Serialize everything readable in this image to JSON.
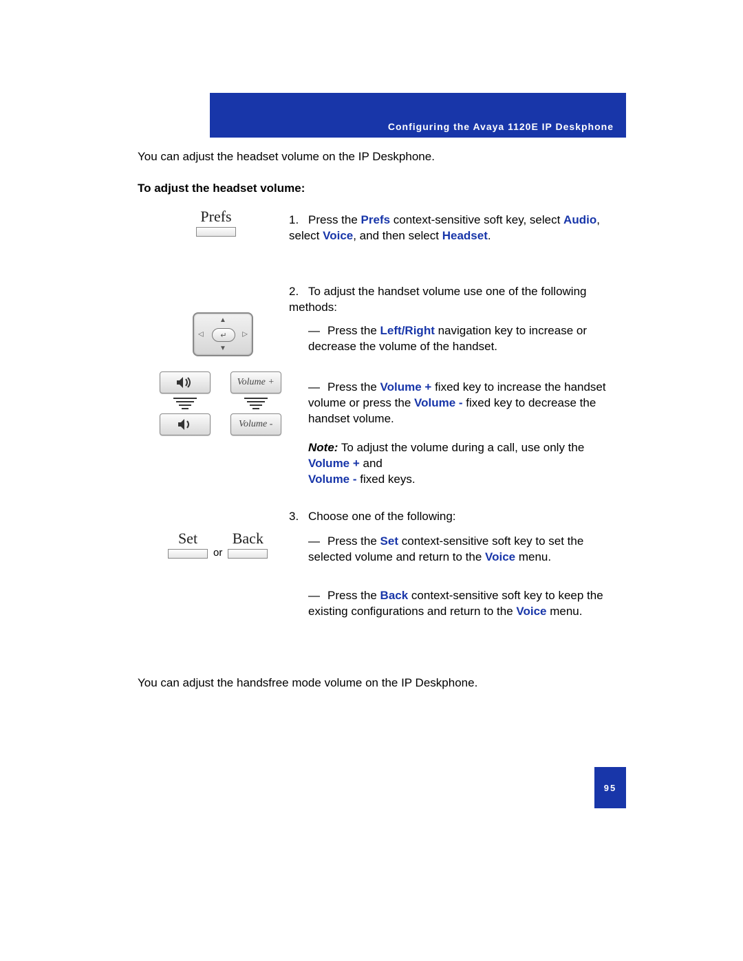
{
  "header": {
    "title": "Configuring the Avaya 1120E IP Deskphone"
  },
  "intro": "You can adjust the headset volume on the IP Deskphone.",
  "subhead": "To adjust the headset volume:",
  "softkeys": {
    "prefs": "Prefs",
    "set": "Set",
    "back": "Back",
    "or": "or"
  },
  "volume": {
    "plus": "Volume +",
    "minus": "Volume -"
  },
  "steps": {
    "s1": {
      "num": "1.",
      "t1": "Press the ",
      "kw1": "Prefs",
      "t2": " context-sensitive soft key, select ",
      "kw2": "Audio",
      "t3": ", select ",
      "kw3": "Voice",
      "t4": ", and then select ",
      "kw4": "Headset",
      "t5": "."
    },
    "s2": {
      "num": "2.",
      "text": "To adjust the handset volume use one of the following methods:"
    },
    "b1": {
      "dash": "—",
      "t1": "Press the ",
      "kw1": "Left/Right",
      "t2": " navigation key to increase or decrease the volume of the handset."
    },
    "b2": {
      "dash": "—",
      "t1": "Press the ",
      "kw1": "Volume +",
      "t2": " fixed key to increase the handset volume or press the ",
      "kw2": "Volume -",
      "t3": " fixed key to decrease the handset volume."
    },
    "note": {
      "label": "Note:",
      "t1": "  To adjust the volume during a call, use only the ",
      "kw1": "Volume +",
      "t2": " and ",
      "kw2": "Volume -",
      "t3": " fixed keys."
    },
    "s3": {
      "num": "3.",
      "text": "Choose one of the following:"
    },
    "b3": {
      "dash": "—",
      "t1": "Press the ",
      "kw1": "Set",
      "t2": " context-sensitive soft key to set the selected volume and return to the ",
      "kw2": "Voice",
      "t3": " menu."
    },
    "b4": {
      "dash": "—",
      "t1": "Press the ",
      "kw1": "Back",
      "t2": " context-sensitive soft key to keep the existing configurations and return to the ",
      "kw2": "Voice",
      "t3": " menu."
    }
  },
  "outro": "You can adjust the handsfree mode volume on the IP Deskphone.",
  "page_number": "95"
}
